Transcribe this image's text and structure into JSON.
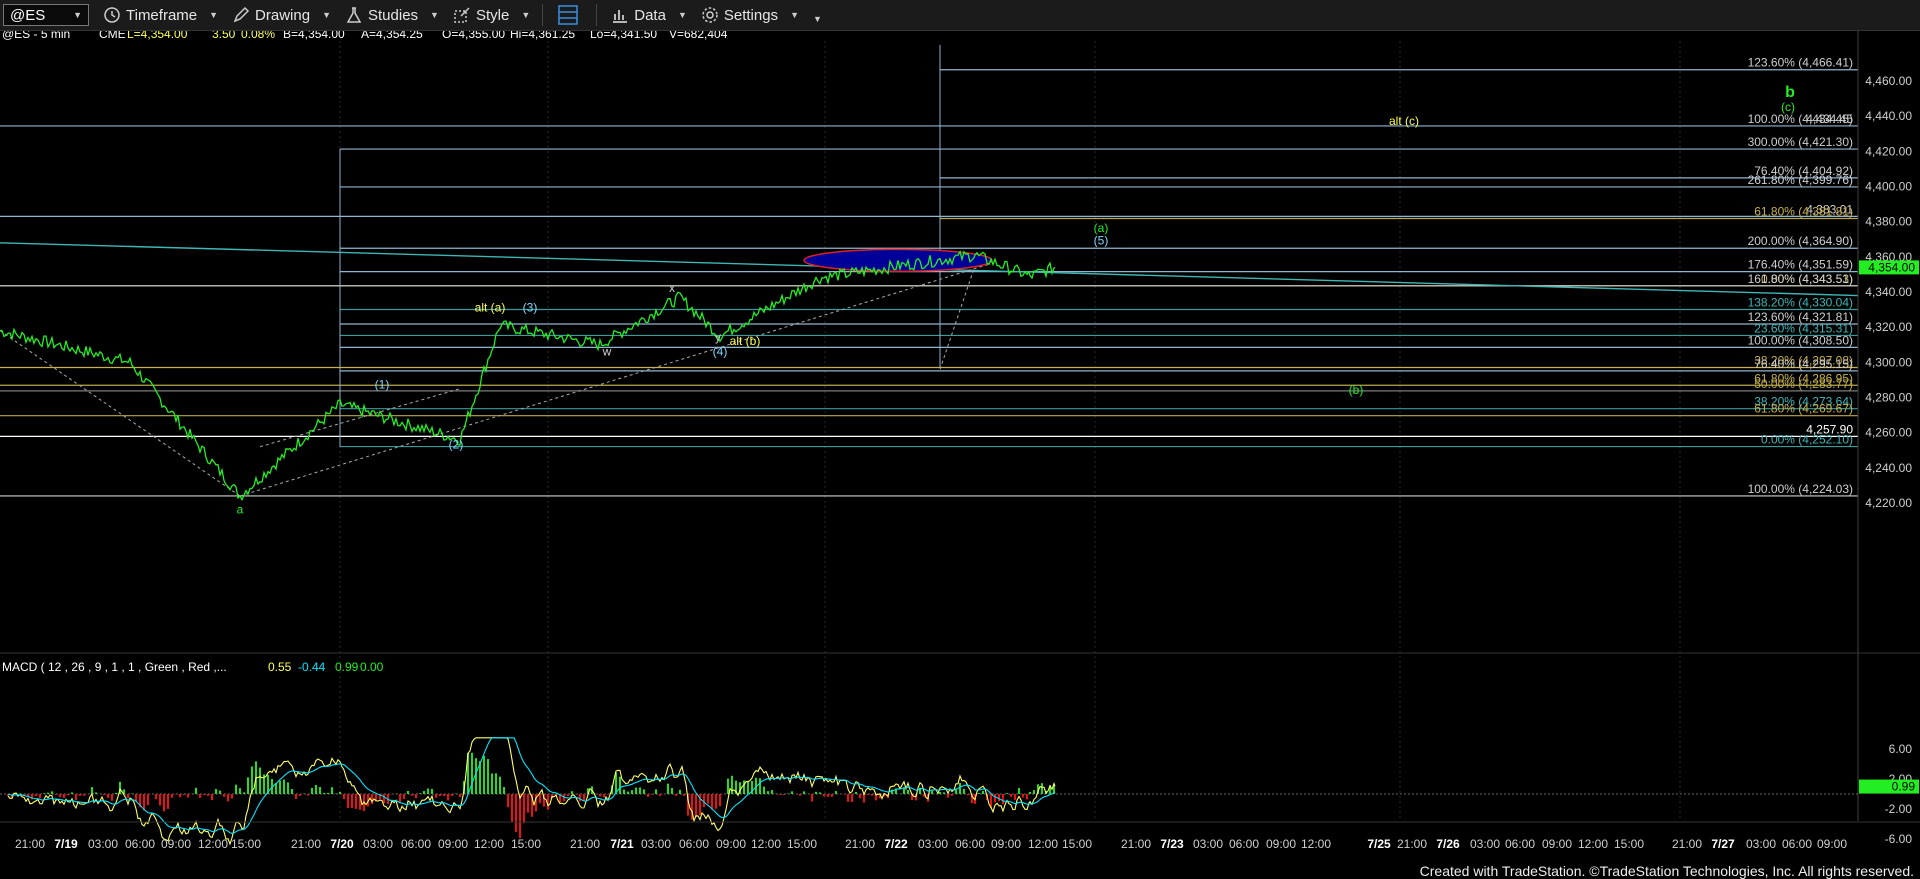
{
  "toolbar": {
    "symbol": "@ES",
    "timeframe": "Timeframe",
    "drawing": "Drawing",
    "studies": "Studies",
    "style": "Style",
    "data": "Data",
    "settings": "Settings"
  },
  "header": {
    "symbol": "@ES - 5 min",
    "exchange": "CME",
    "last": "L=4,354.00",
    "change": "3.50",
    "change_pct": "0.08%",
    "bid": "B=4,354.00",
    "ask": "A=4,354.25",
    "open": "O=4,355.00",
    "high": "Hi=4,361.25",
    "low": "Lo=4,341.50",
    "volume": "V=682,404"
  },
  "price_axis": {
    "ticks": [
      "4,460.00",
      "4,440.00",
      "4,420.00",
      "4,400.00",
      "4,380.00",
      "4,360.00",
      "4,340.00",
      "4,320.00",
      "4,300.00",
      "4,280.00",
      "4,260.00",
      "4,240.00",
      "4,220.00"
    ],
    "last_price_label": "4,354.00"
  },
  "macd": {
    "label": "MACD ( 12 , 26 , 9 , 1 , 1 , Green , Red ,...",
    "macd_value": "0.55",
    "signal_value": "-0.44",
    "diff_value": "0.99",
    "extra_value": "0.00",
    "axis_ticks": [
      "6.00",
      "2.00",
      "-2.00",
      "-6.00"
    ],
    "last_label": "0.99"
  },
  "time_axis": [
    "21:00",
    "7/19",
    "03:00",
    "06:00",
    "09:00",
    "12:00",
    "15:00",
    "21:00",
    "7/20",
    "03:00",
    "06:00",
    "09:00",
    "12:00",
    "15:00",
    "21:00",
    "7/21",
    "03:00",
    "06:00",
    "09:00",
    "12:00",
    "15:00",
    "21:00",
    "7/22",
    "03:00",
    "06:00",
    "09:00",
    "12:00",
    "15:00",
    "21:00",
    "7/23",
    "03:00",
    "06:00",
    "09:00",
    "12:00",
    "7/25",
    "21:00",
    "7/26",
    "03:00",
    "06:00",
    "09:00",
    "12:00",
    "15:00",
    "21:00",
    "7/27",
    "03:00",
    "06:00",
    "09:00"
  ],
  "wave_labels": [
    "a",
    "(1)",
    "(2)",
    "(3)",
    "(4)",
    "(5)",
    "alt (a)",
    "alt (b)",
    "alt (c)",
    "w",
    "x",
    "y",
    "(a)",
    "(b)",
    "b",
    "(c)"
  ],
  "fib_labels": [
    "123.60% (4,466.41)",
    "100.00% (4,434.45)",
    "4,434.45",
    "300.00% (4,421.30)",
    "76.40% (4,404.92)",
    "261.80% (4,399.76)",
    "4,383.01",
    "61.80% (4,381.81)",
    "200.00% (4,364.90)",
    "176.40% (4,351.59)",
    "0.00% (4,343.53)",
    "161.80% (4,343.51)",
    "138.20% (4,330.04)",
    "123.60% (4,321.81)",
    "23.60% (4,315.31)",
    "100.00% (4,308.50)",
    "38.20% (4,297.08)",
    "76.40% (4,295.15)",
    "61.80% (4,286.95)",
    "50.00% (4,283.77)",
    "38.20% (4,273.64)",
    "61.80% (4,269.67)",
    "4,257.90",
    "0.00% (4,252.10)",
    "100.00% (4,224.03)"
  ],
  "footer": "Created with TradeStation. ©TradeStation Technologies, Inc. All rights reserved.",
  "chart_data": {
    "type": "line",
    "title": "@ES - 5 min",
    "x": [
      "7/19 21:00",
      "7/19 09:00",
      "7/19 14:00",
      "7/20 00:00",
      "7/20 09:00",
      "7/20 12:00",
      "7/20 22:00",
      "7/21 04:00",
      "7/21 08:00",
      "7/21 15:00",
      "7/22 00:00",
      "7/22 06:00",
      "7/22 09:00",
      "7/22 12:00"
    ],
    "series": [
      {
        "values": [
          4318,
          4300,
          4224,
          4276,
          4256,
          4321,
          4310,
          4337,
          4315,
          4348,
          4355,
          4361,
          4349,
          4354
        ]
      }
    ],
    "ylim": [
      4210,
      4470
    ],
    "y_ticks": [
      4220,
      4240,
      4260,
      4280,
      4300,
      4320,
      4340,
      4360,
      4380,
      4400,
      4420,
      4440,
      4460
    ],
    "macd_ylim": [
      -8,
      8
    ],
    "colors": {
      "price": "#22ee22",
      "macd": "#ffff66",
      "signal": "#00e5ff",
      "hist_up": "#22dd22",
      "hist_down": "#ee1111",
      "trendline": "#3fb6b6",
      "highlight": "#000099",
      "highlight_border": "#dd2222"
    }
  }
}
